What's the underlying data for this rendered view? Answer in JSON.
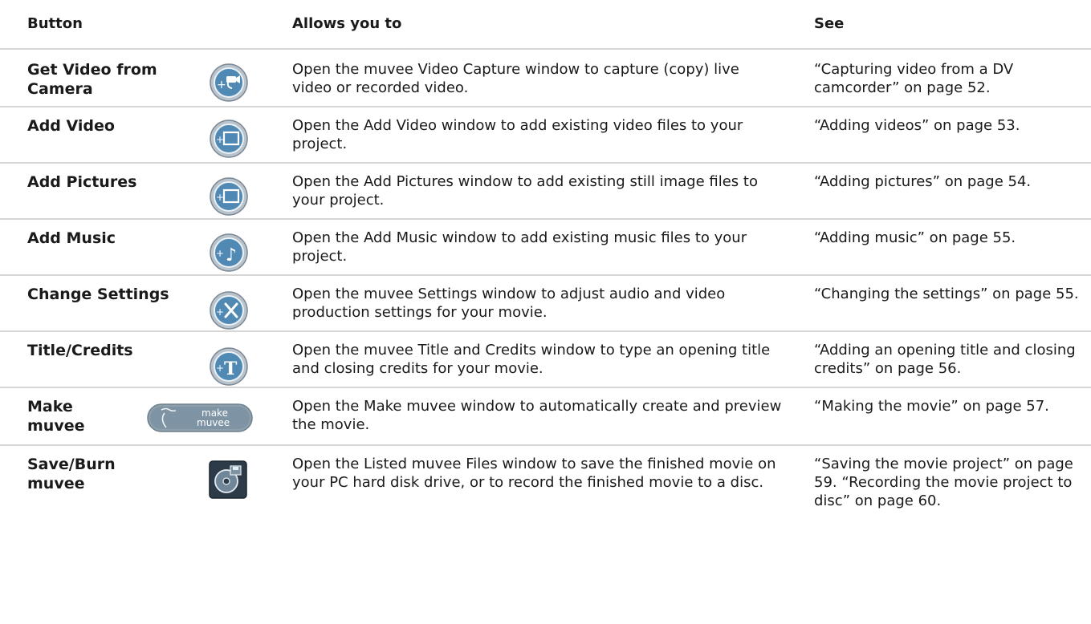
{
  "headers": {
    "button": "Button",
    "allows": "Allows you to",
    "see": "See"
  },
  "rows": [
    {
      "button": "Get Video from Camera",
      "icon": "camera-plus-icon",
      "desc": "Open the muvee Video Capture window to capture (copy) live video or recorded video.",
      "see": "“Capturing video from a DV camcorder” on page 52."
    },
    {
      "button": "Add Video",
      "icon": "film-plus-icon",
      "desc": "Open the Add Video window to add existing video files to your project.",
      "see": "“Adding videos” on page 53."
    },
    {
      "button": "Add Pictures",
      "icon": "picture-plus-icon",
      "desc": "Open the Add Pictures window to add existing still image files to your project.",
      "see": "“Adding pictures” on page 54."
    },
    {
      "button": "Add Music",
      "icon": "music-note-plus-icon",
      "desc": "Open the Add Music window to add existing music files to your project.",
      "see": "“Adding music” on page 55."
    },
    {
      "button": "Change Settings",
      "icon": "settings-tools-plus-icon",
      "desc": "Open the muvee Settings window to adjust audio and video production settings for your movie.",
      "see": "“Changing the settings” on page 55."
    },
    {
      "button": "Title/Credits",
      "icon": "title-t-plus-icon",
      "desc": "Open the muvee Title and Credits window to type an opening title and closing credits for your movie.",
      "see": "“Adding an opening title and closing credits” on page 56."
    },
    {
      "button": "Make muvee",
      "icon": "make-muvee-icon",
      "icon_text": "make muvee",
      "desc": "Open the Make muvee window to automatically create and preview the movie.",
      "see": "“Making the movie” on page 57."
    },
    {
      "button": "Save/Burn muvee",
      "icon": "save-burn-disc-icon",
      "desc": "Open the Listed muvee Files window to save the finished movie on your PC hard disk drive, or to record the finished movie to a disc.",
      "see": "“Saving the movie project” on page 59. “Recording the movie project to disc” on page 60."
    }
  ]
}
